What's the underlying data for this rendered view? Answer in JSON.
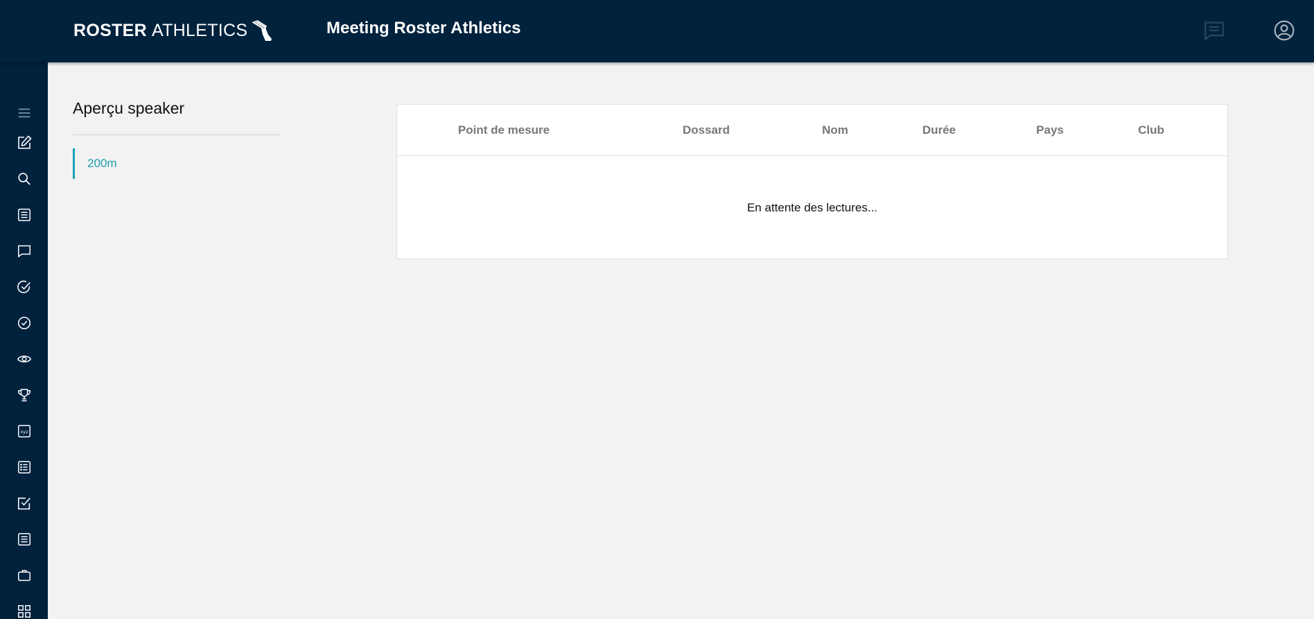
{
  "header": {
    "logo_bold": "ROSTER",
    "logo_light": "ATHLETICS",
    "app_title": "Meeting Roster Athletics",
    "icons": [
      "chat-icon",
      "account-circle-icon"
    ]
  },
  "sidebar": {
    "icons": [
      "menu-icon",
      "edit-icon",
      "search-icon",
      "document-list-icon",
      "comment-icon",
      "check-circle-icon",
      "check-badge-icon",
      "eye-icon",
      "trophy-icon",
      "xyz-icon",
      "list-icon",
      "checkbox-icon",
      "article-icon",
      "briefcase-icon",
      "grid-icon"
    ]
  },
  "main": {
    "section_title": "Aperçu speaker",
    "nav_items": [
      {
        "label": "200m",
        "active": true
      }
    ],
    "table": {
      "columns": [
        "Point de mesure",
        "Dossard",
        "Nom",
        "Durée",
        "Pays",
        "Club"
      ],
      "empty_message": "En attente des lectures..."
    }
  },
  "colors": {
    "navy": "#00223d",
    "accent": "#1a9fb0",
    "background": "#f2f2f2"
  }
}
